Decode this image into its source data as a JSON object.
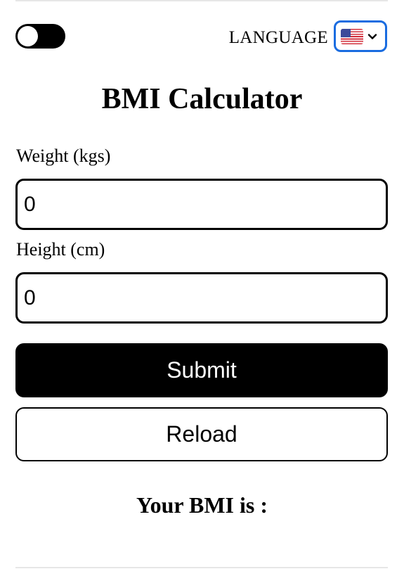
{
  "header": {
    "theme_toggle": {
      "state": "off",
      "icon": "toggle-switch-icon"
    },
    "language_label": "LANGUAGE",
    "language_select": {
      "selected_value": "🇺🇸",
      "icon": "us-flag-icon",
      "accent_color": "#1a6ce0"
    }
  },
  "main": {
    "title": "BMI Calculator",
    "weight": {
      "label": "Weight (kgs)",
      "value": "0"
    },
    "height": {
      "label": "Height (cm)",
      "value": "0"
    },
    "submit_label": "Submit",
    "reload_label": "Reload",
    "result_text": "Your BMI is :"
  },
  "colors": {
    "primary": "#000000",
    "background": "#ffffff",
    "select_border": "#1a6ce0"
  }
}
